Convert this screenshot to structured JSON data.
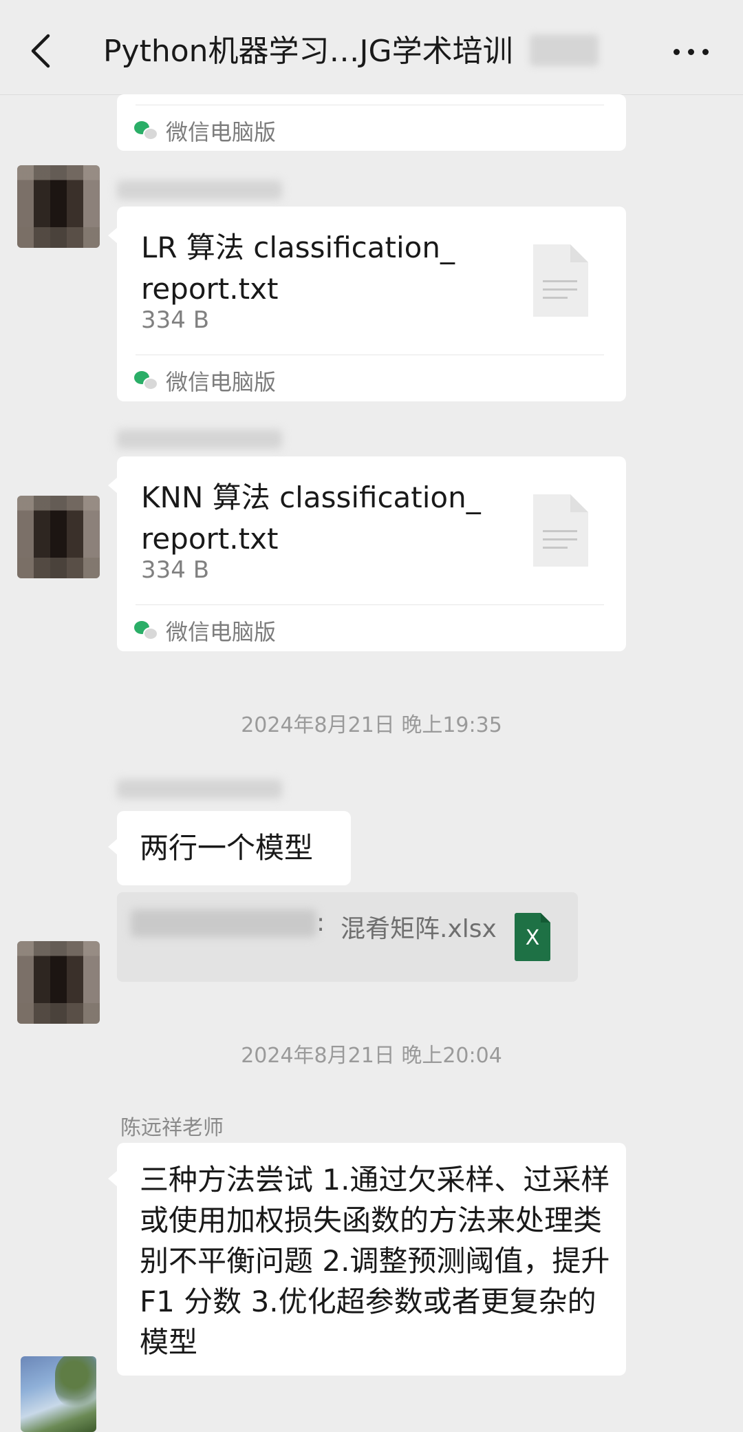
{
  "header": {
    "title": "Python机器学习…JG学术培训"
  },
  "messages": {
    "top_card": {
      "source": "微信电脑版"
    },
    "file1": {
      "name": "LR 算法 classification_ report.txt",
      "size": "334 B",
      "source": "微信电脑版"
    },
    "file2": {
      "name": "KNN 算法 classification_ report.txt",
      "size": "334 B",
      "source": "微信电脑版"
    },
    "time1": "2024年8月21日 晚上19:35",
    "text1": "两行一个模型",
    "quote": {
      "sep": ":",
      "file": "混肴矩阵.xlsx",
      "icon_text": "X"
    },
    "time2": "2024年8月21日 晚上20:04",
    "teacher": {
      "name": "陈远祥老师",
      "text": "三种方法尝试 1.通过欠采样、过采样或使用加权损失函数的方法来处理类别不平衡问题 2.调整预测阈值，提升 F1 分数 3.优化超参数或者更复杂的模型"
    }
  },
  "colors": {
    "background": "#ededed",
    "bubble": "#ffffff",
    "wechat_green": "#2aae67",
    "excel_green": "#1e7145"
  }
}
